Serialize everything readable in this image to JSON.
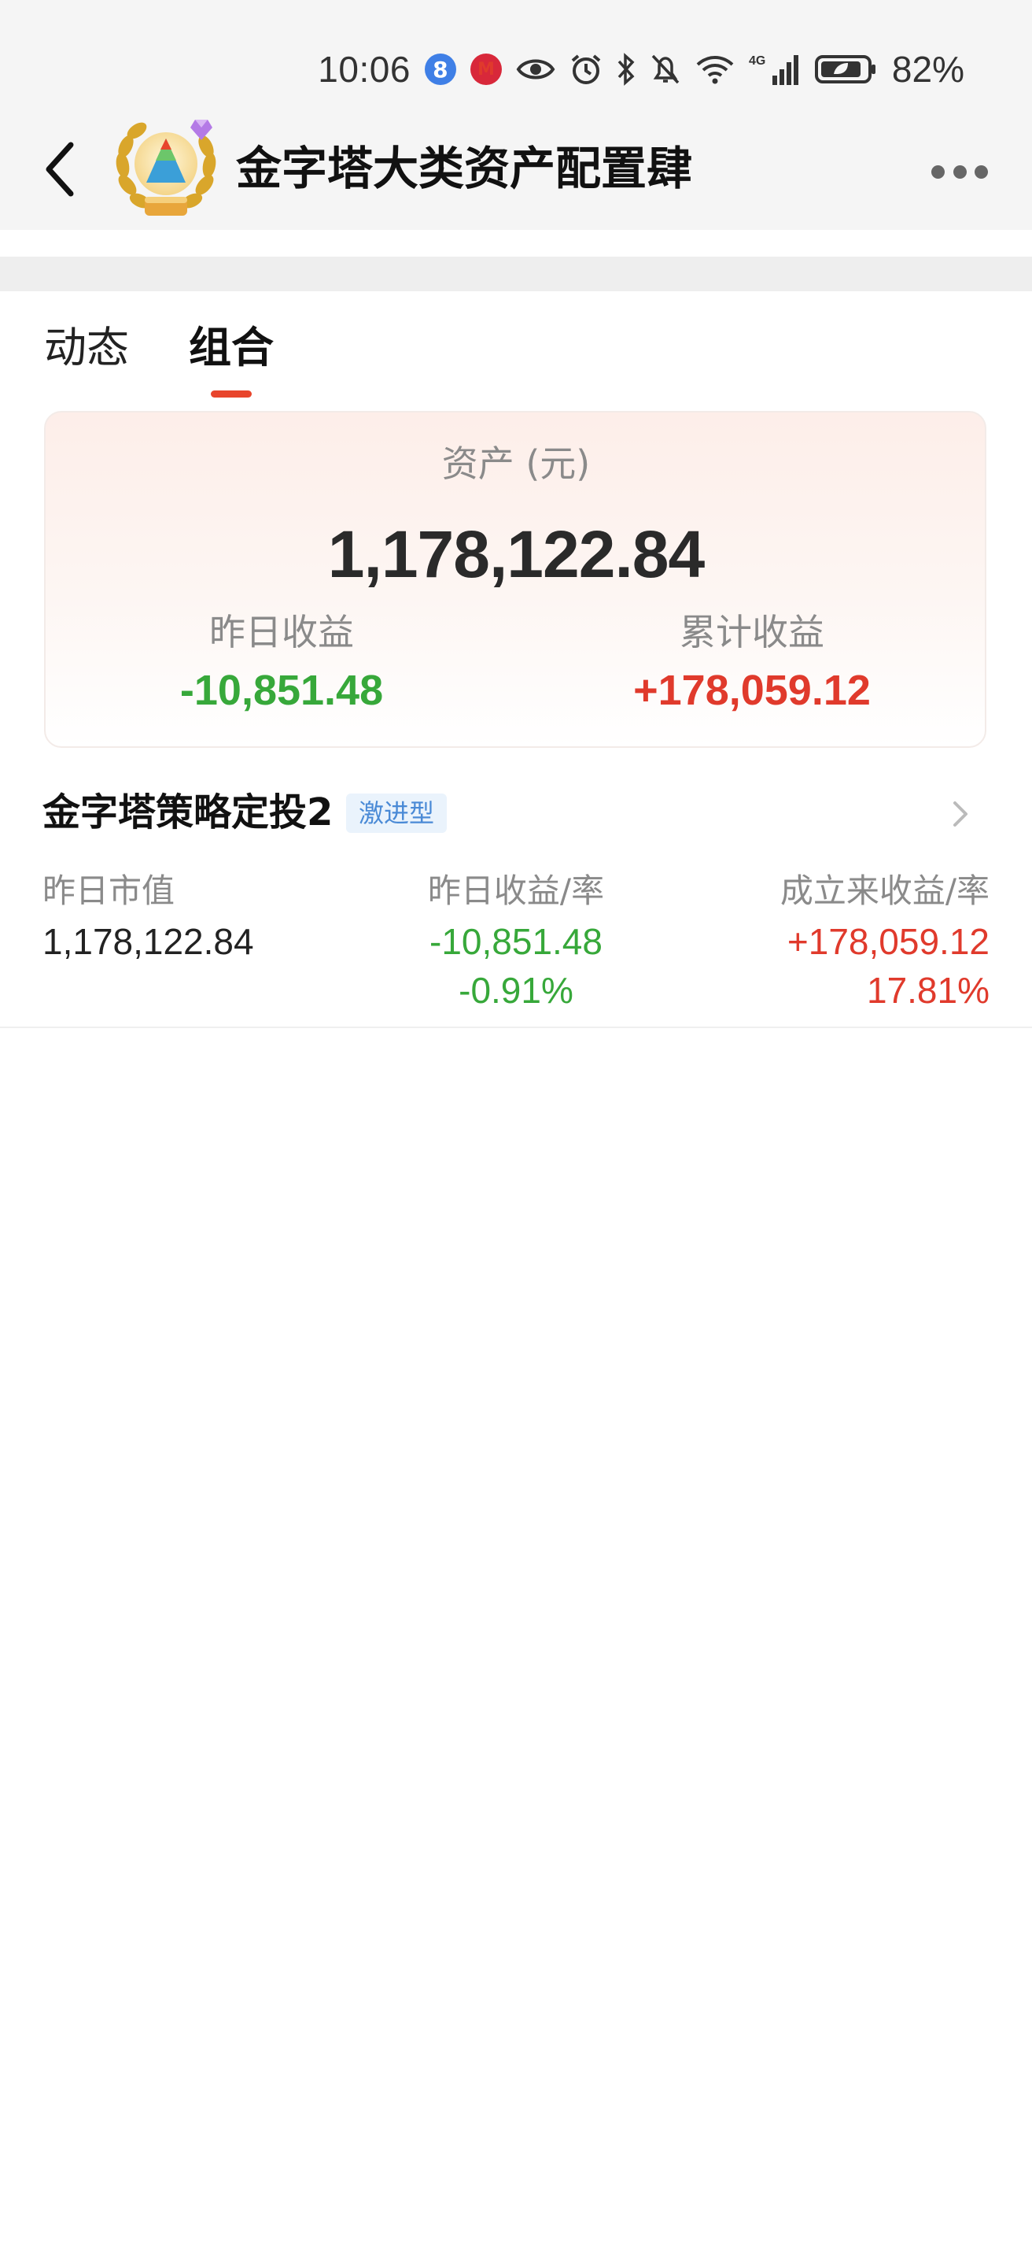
{
  "status_bar": {
    "time": "10:06",
    "badge_8": "8",
    "badge_m": "M",
    "network": "4G",
    "battery": "82%"
  },
  "header": {
    "title": "金字塔大类资产配置肆"
  },
  "tabs": [
    {
      "label": "动态",
      "active": false
    },
    {
      "label": "组合",
      "active": true
    }
  ],
  "summary": {
    "asset_label": "资产 (元)",
    "asset_value": "1,178,122.84",
    "yesterday_label": "昨日收益",
    "yesterday_value": "-10,851.48",
    "total_label": "累计收益",
    "total_value": "+178,059.12"
  },
  "strategy": {
    "name": "金字塔策略定投2",
    "tag": "激进型",
    "market_value_label": "昨日市值",
    "market_value": "1,178,122.84",
    "daily_label": "昨日收益/率",
    "daily_amount": "-10,851.48",
    "daily_rate": "-0.91%",
    "inception_label": "成立来收益/率",
    "inception_amount": "+178,059.12",
    "inception_rate": "17.81%"
  },
  "colors": {
    "accent": "#e8452c",
    "gain": "#e03a2c",
    "loss": "#37a83a",
    "tag_bg": "#eaf3fc",
    "tag_text": "#4a8ad6"
  }
}
